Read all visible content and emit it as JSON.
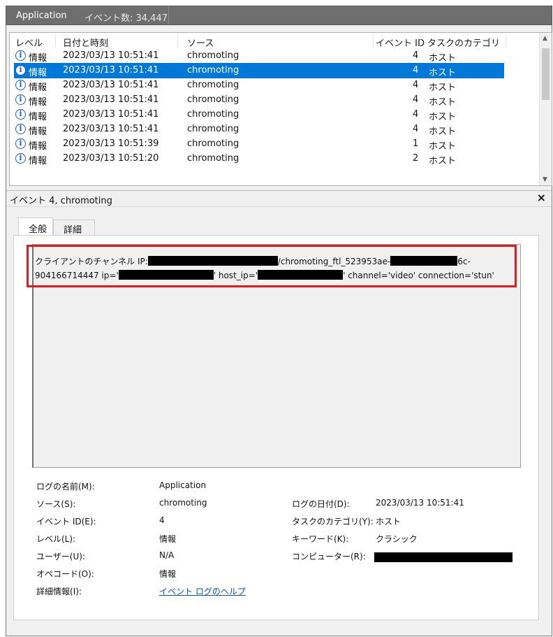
{
  "titlebar": {
    "log_name": "Application",
    "event_count": "イベント数: 34,447"
  },
  "list": {
    "columns": {
      "level": "レベル",
      "datetime": "日付と時刻",
      "source": "ソース",
      "event_id": "イベント ID",
      "category": "タスクのカテゴリ"
    },
    "rows": [
      {
        "level": "情報",
        "datetime": "2023/03/13 10:51:41",
        "source": "chromoting",
        "event_id": "4",
        "category": "ホスト",
        "selected": false
      },
      {
        "level": "情報",
        "datetime": "2023/03/13 10:51:41",
        "source": "chromoting",
        "event_id": "4",
        "category": "ホスト",
        "selected": true
      },
      {
        "level": "情報",
        "datetime": "2023/03/13 10:51:41",
        "source": "chromoting",
        "event_id": "4",
        "category": "ホスト",
        "selected": false
      },
      {
        "level": "情報",
        "datetime": "2023/03/13 10:51:41",
        "source": "chromoting",
        "event_id": "4",
        "category": "ホスト",
        "selected": false
      },
      {
        "level": "情報",
        "datetime": "2023/03/13 10:51:41",
        "source": "chromoting",
        "event_id": "4",
        "category": "ホスト",
        "selected": false
      },
      {
        "level": "情報",
        "datetime": "2023/03/13 10:51:41",
        "source": "chromoting",
        "event_id": "4",
        "category": "ホスト",
        "selected": false
      },
      {
        "level": "情報",
        "datetime": "2023/03/13 10:51:39",
        "source": "chromoting",
        "event_id": "1",
        "category": "ホスト",
        "selected": false
      },
      {
        "level": "情報",
        "datetime": "2023/03/13 10:51:20",
        "source": "chromoting",
        "event_id": "2",
        "category": "ホスト",
        "selected": false
      }
    ]
  },
  "detail": {
    "title": "イベント 4, chromoting",
    "close_label": "×",
    "tabs": {
      "general": "全般",
      "details": "詳細"
    },
    "message": {
      "p1": "クライアントのチャンネル IP:",
      "p2": "/chromoting_ftl_523953ae-",
      "p3": "6c-",
      "p4": "904166714447 ip='",
      "p5": "' host_ip='",
      "p6": "' channel='video' connection='stun'"
    },
    "properties": {
      "log_name_label": "ログの名前(M):",
      "log_name": "Application",
      "source_label": "ソース(S):",
      "source": "chromoting",
      "logged_label": "ログの日付(D):",
      "logged": "2023/03/13 10:51:41",
      "event_id_label": "イベント ID(E):",
      "event_id": "4",
      "task_category_label": "タスクのカテゴリ(Y):",
      "task_category": "ホスト",
      "level_label": "レベル(L):",
      "level": "情報",
      "keywords_label": "キーワード(K):",
      "keywords": "クラシック",
      "user_label": "ユーザー(U):",
      "user": "N/A",
      "computer_label": "コンピューター(R):",
      "opcode_label": "オペコード(O):",
      "opcode": "情報",
      "more_info_label": "詳細情報(I):",
      "more_info_link": "イベント ログのヘルプ"
    }
  },
  "colors": {
    "selection": "#0078d7",
    "highlight_box": "#e11b22",
    "link": "#0a4fc7"
  },
  "icons": {
    "info": "info-circle-icon",
    "close": "close-icon"
  }
}
